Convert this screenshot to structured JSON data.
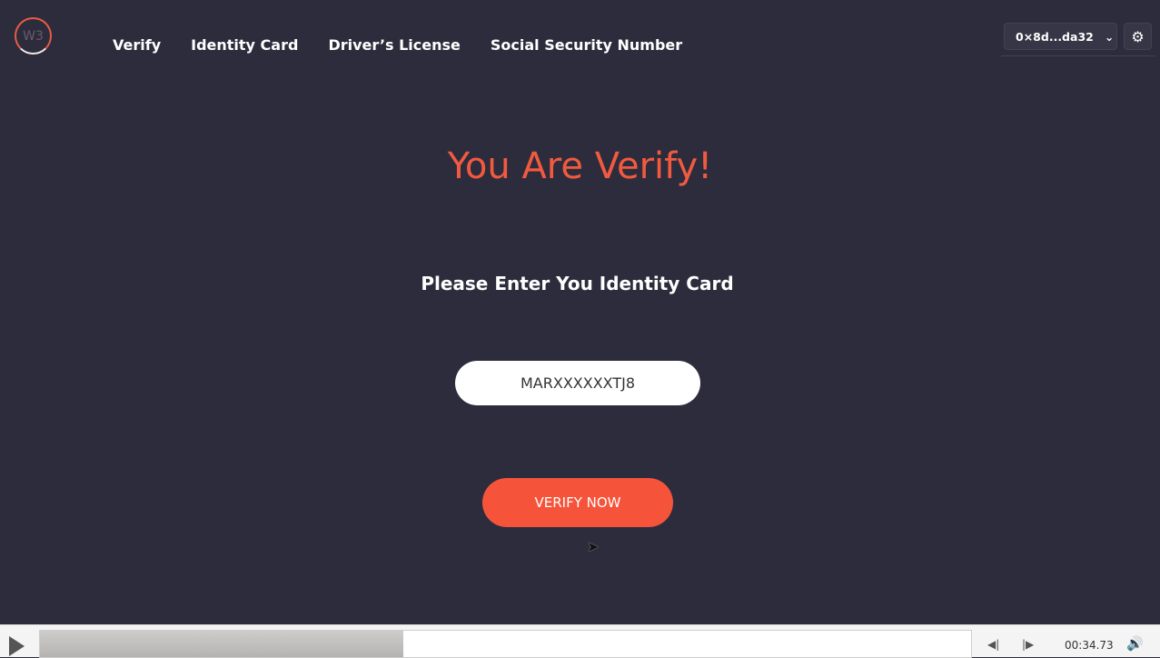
{
  "header": {
    "logo_text": "W3",
    "nav": [
      "Verify",
      "Identity Card",
      "Driver’s License",
      "Social Security Number"
    ],
    "wallet_address": "0×8d...da32"
  },
  "main": {
    "title": "You Are Verify!",
    "subtitle": "Please Enter You Identity Card",
    "id_input_value": "MARXXXXXXTJ8",
    "verify_button": "VERIFY NOW"
  },
  "player": {
    "time": "00:34.73",
    "progress": 0.39
  },
  "colors": {
    "background": "#2d2c3c",
    "accent": "#f5543a"
  }
}
